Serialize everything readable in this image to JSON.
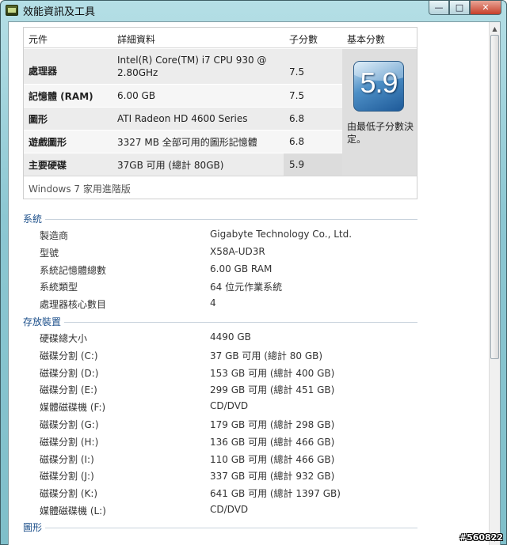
{
  "window": {
    "title": "效能資訊及工具",
    "buttons": {
      "minimize": "—",
      "maximize": "□",
      "close": "✕"
    }
  },
  "score_table": {
    "headers": {
      "component": "元件",
      "details": "詳細資料",
      "subscore": "子分數",
      "base_score": "基本分數"
    },
    "rows": [
      {
        "component": "處理器",
        "details": "Intel(R) Core(TM) i7 CPU 930 @ 2.80GHz",
        "subscore": "7.5"
      },
      {
        "component": "記憶體 (RAM)",
        "details": "6.00 GB",
        "subscore": "7.5"
      },
      {
        "component": "圖形",
        "details": "ATI Radeon HD 4600 Series",
        "subscore": "6.8"
      },
      {
        "component": "遊戲圖形",
        "details": "3327 MB 全部可用的圖形記憶體",
        "subscore": "6.8"
      },
      {
        "component": "主要硬碟",
        "details": "37GB 可用 (總計 80GB)",
        "subscore": "5.9"
      }
    ],
    "base_score": "5.9",
    "base_caption": "由最低子分數決定。",
    "os_edition": "Windows 7 家用進階版"
  },
  "system": {
    "heading": "系統",
    "rows": [
      {
        "label": "製造商",
        "value": "Gigabyte Technology Co., Ltd."
      },
      {
        "label": "型號",
        "value": "X58A-UD3R"
      },
      {
        "label": "系統記憶體總數",
        "value": "6.00 GB RAM"
      },
      {
        "label": "系統類型",
        "value": "64 位元作業系統"
      },
      {
        "label": "處理器核心數目",
        "value": "4"
      }
    ]
  },
  "storage": {
    "heading": "存放裝置",
    "rows": [
      {
        "label": "硬碟總大小",
        "value": "4490 GB"
      },
      {
        "label": "磁碟分割 (C:)",
        "value": "37 GB 可用 (總計 80 GB)"
      },
      {
        "label": "磁碟分割 (D:)",
        "value": "153 GB 可用 (總計 400 GB)"
      },
      {
        "label": "磁碟分割 (E:)",
        "value": "299 GB 可用 (總計 451 GB)"
      },
      {
        "label": "媒體磁碟機 (F:)",
        "value": "CD/DVD"
      },
      {
        "label": "磁碟分割 (G:)",
        "value": "179 GB 可用 (總計 298 GB)"
      },
      {
        "label": "磁碟分割 (H:)",
        "value": "136 GB 可用 (總計 466 GB)"
      },
      {
        "label": "磁碟分割 (I:)",
        "value": "110 GB 可用 (總計 466 GB)"
      },
      {
        "label": "磁碟分割 (J:)",
        "value": "337 GB 可用 (總計 932 GB)"
      },
      {
        "label": "磁碟分割 (K:)",
        "value": "641 GB 可用 (總計 1397 GB)"
      },
      {
        "label": "媒體磁碟機 (L:)",
        "value": "CD/DVD"
      }
    ]
  },
  "graphics": {
    "heading": "圖形"
  },
  "watermark": "#560822"
}
